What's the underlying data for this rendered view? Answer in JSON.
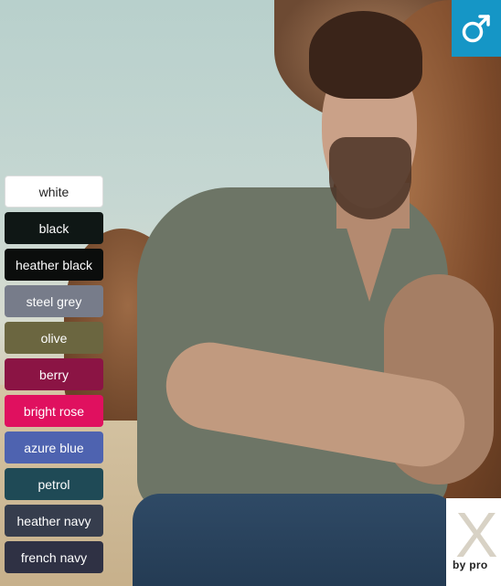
{
  "gender_badge": {
    "icon": "male-symbol-icon",
    "color": "#1596c6"
  },
  "colors": [
    {
      "label": "white",
      "hex": "#ffffff"
    },
    {
      "label": "black",
      "hex": "#0f1715"
    },
    {
      "label": "heather black",
      "hex": "#0b0d0c"
    },
    {
      "label": "steel grey",
      "hex": "#777c8a"
    },
    {
      "label": "olive",
      "hex": "#6b6640"
    },
    {
      "label": "berry",
      "hex": "#8b1444"
    },
    {
      "label": "bright rose",
      "hex": "#e0105f"
    },
    {
      "label": "azure blue",
      "hex": "#4e63b0"
    },
    {
      "label": "petrol",
      "hex": "#1f4a56"
    },
    {
      "label": "heather navy",
      "hex": "#363d4d"
    },
    {
      "label": "french navy",
      "hex": "#2f3144"
    }
  ],
  "logo": {
    "mark": "X",
    "tagline": "by pro"
  }
}
